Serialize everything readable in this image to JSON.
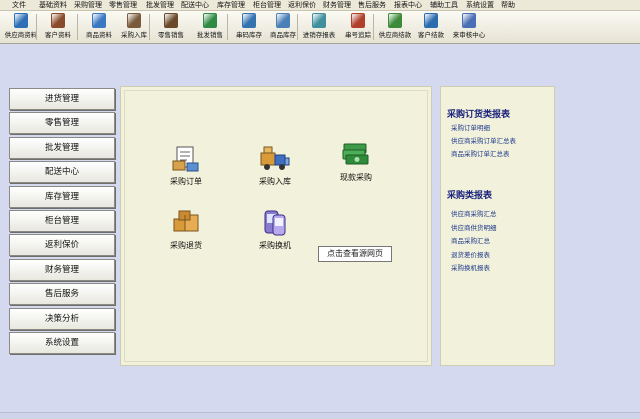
{
  "menu": [
    "文件",
    "基础资料",
    "采购管理",
    "零售管理",
    "批发管理",
    "配送中心",
    "库存管理",
    "柜台管理",
    "返利保价",
    "财务管理",
    "售后服务",
    "报表中心",
    "辅助工具",
    "系统设置",
    "帮助"
  ],
  "toolbar": [
    {
      "label": "供应商资料",
      "icon": "supplier-icon",
      "color": "#2e6fb5"
    },
    {
      "label": "客户资料",
      "icon": "customer-icon",
      "color": "#8a4b2b"
    },
    {
      "label": "商品资料",
      "icon": "goods-icon",
      "color": "#3a78c2"
    },
    {
      "label": "采购入库",
      "icon": "purchase-in-icon",
      "color": "#7a5a3a"
    },
    {
      "label": "零售销售",
      "icon": "retail-sale-icon",
      "color": "#6a4a2a"
    },
    {
      "label": "批发销售",
      "icon": "wholesale-icon",
      "color": "#2f8a43"
    },
    {
      "label": "串码库存",
      "icon": "serial-stock-icon",
      "color": "#3572b0"
    },
    {
      "label": "商品库存",
      "icon": "goods-stock-icon",
      "color": "#4a7fb8"
    },
    {
      "label": "进销存报表",
      "icon": "report-icon",
      "color": "#3f8f9c"
    },
    {
      "label": "串号追踪",
      "icon": "serial-track-icon",
      "color": "#b0402c"
    },
    {
      "label": "供应商结款",
      "icon": "supplier-payment-icon",
      "color": "#3d8a3a"
    },
    {
      "label": "客户结款",
      "icon": "customer-payment-icon",
      "color": "#2b6cb0"
    },
    {
      "label": "来审核中心",
      "icon": "audit-center-icon",
      "color": "#4a6fb5"
    }
  ],
  "sidenav": [
    "进货管理",
    "零售管理",
    "批发管理",
    "配送中心",
    "库存管理",
    "柜台管理",
    "返利保价",
    "财务管理",
    "售后服务",
    "决策分析",
    "系统设置"
  ],
  "functions": [
    {
      "label": "采购订单",
      "icon": "purchase-order-icon"
    },
    {
      "label": "采购入库",
      "icon": "purchase-receipt-icon"
    },
    {
      "label": "现款采购",
      "icon": "cash-purchase-icon"
    },
    {
      "label": "采购退货",
      "icon": "purchase-return-icon"
    },
    {
      "label": "采购换机",
      "icon": "purchase-exchange-icon"
    }
  ],
  "tooltip": "点击查看源网页",
  "reports": {
    "order_heading": "采购订货类报表",
    "order_links": [
      "采购订单明细",
      "供应商采购订单汇总表",
      "商品采购订单汇总表"
    ],
    "purchase_heading": "采购类报表",
    "purchase_links": [
      "供应商采购汇总",
      "供应商供货明细",
      "商品采购汇总",
      "退货差价报表",
      "采购换机报表"
    ]
  }
}
